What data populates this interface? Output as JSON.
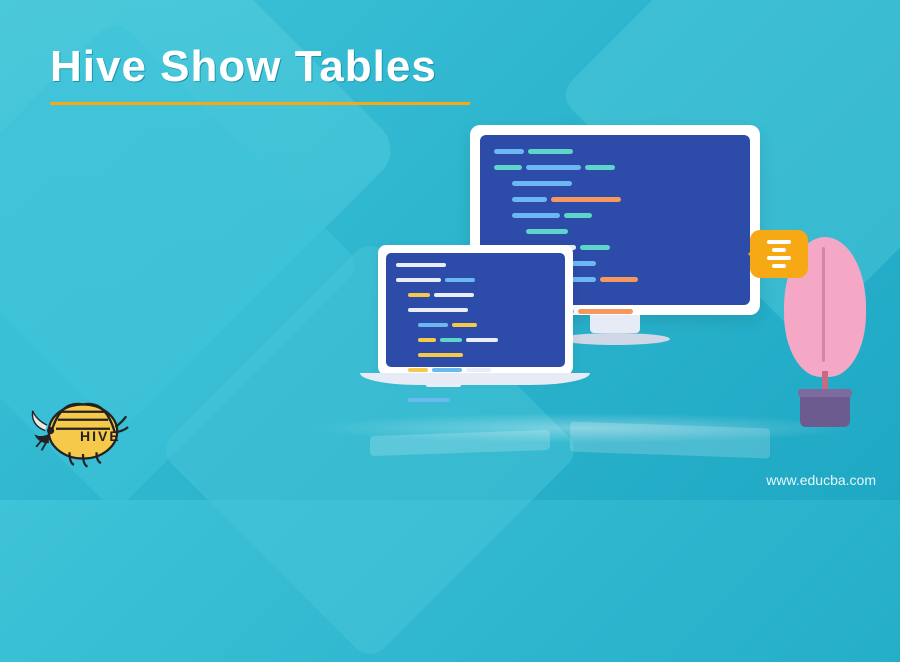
{
  "title": "Hive Show Tables",
  "logo_text": "HIVE",
  "url": "www.educba.com",
  "bubble_lines": 4
}
